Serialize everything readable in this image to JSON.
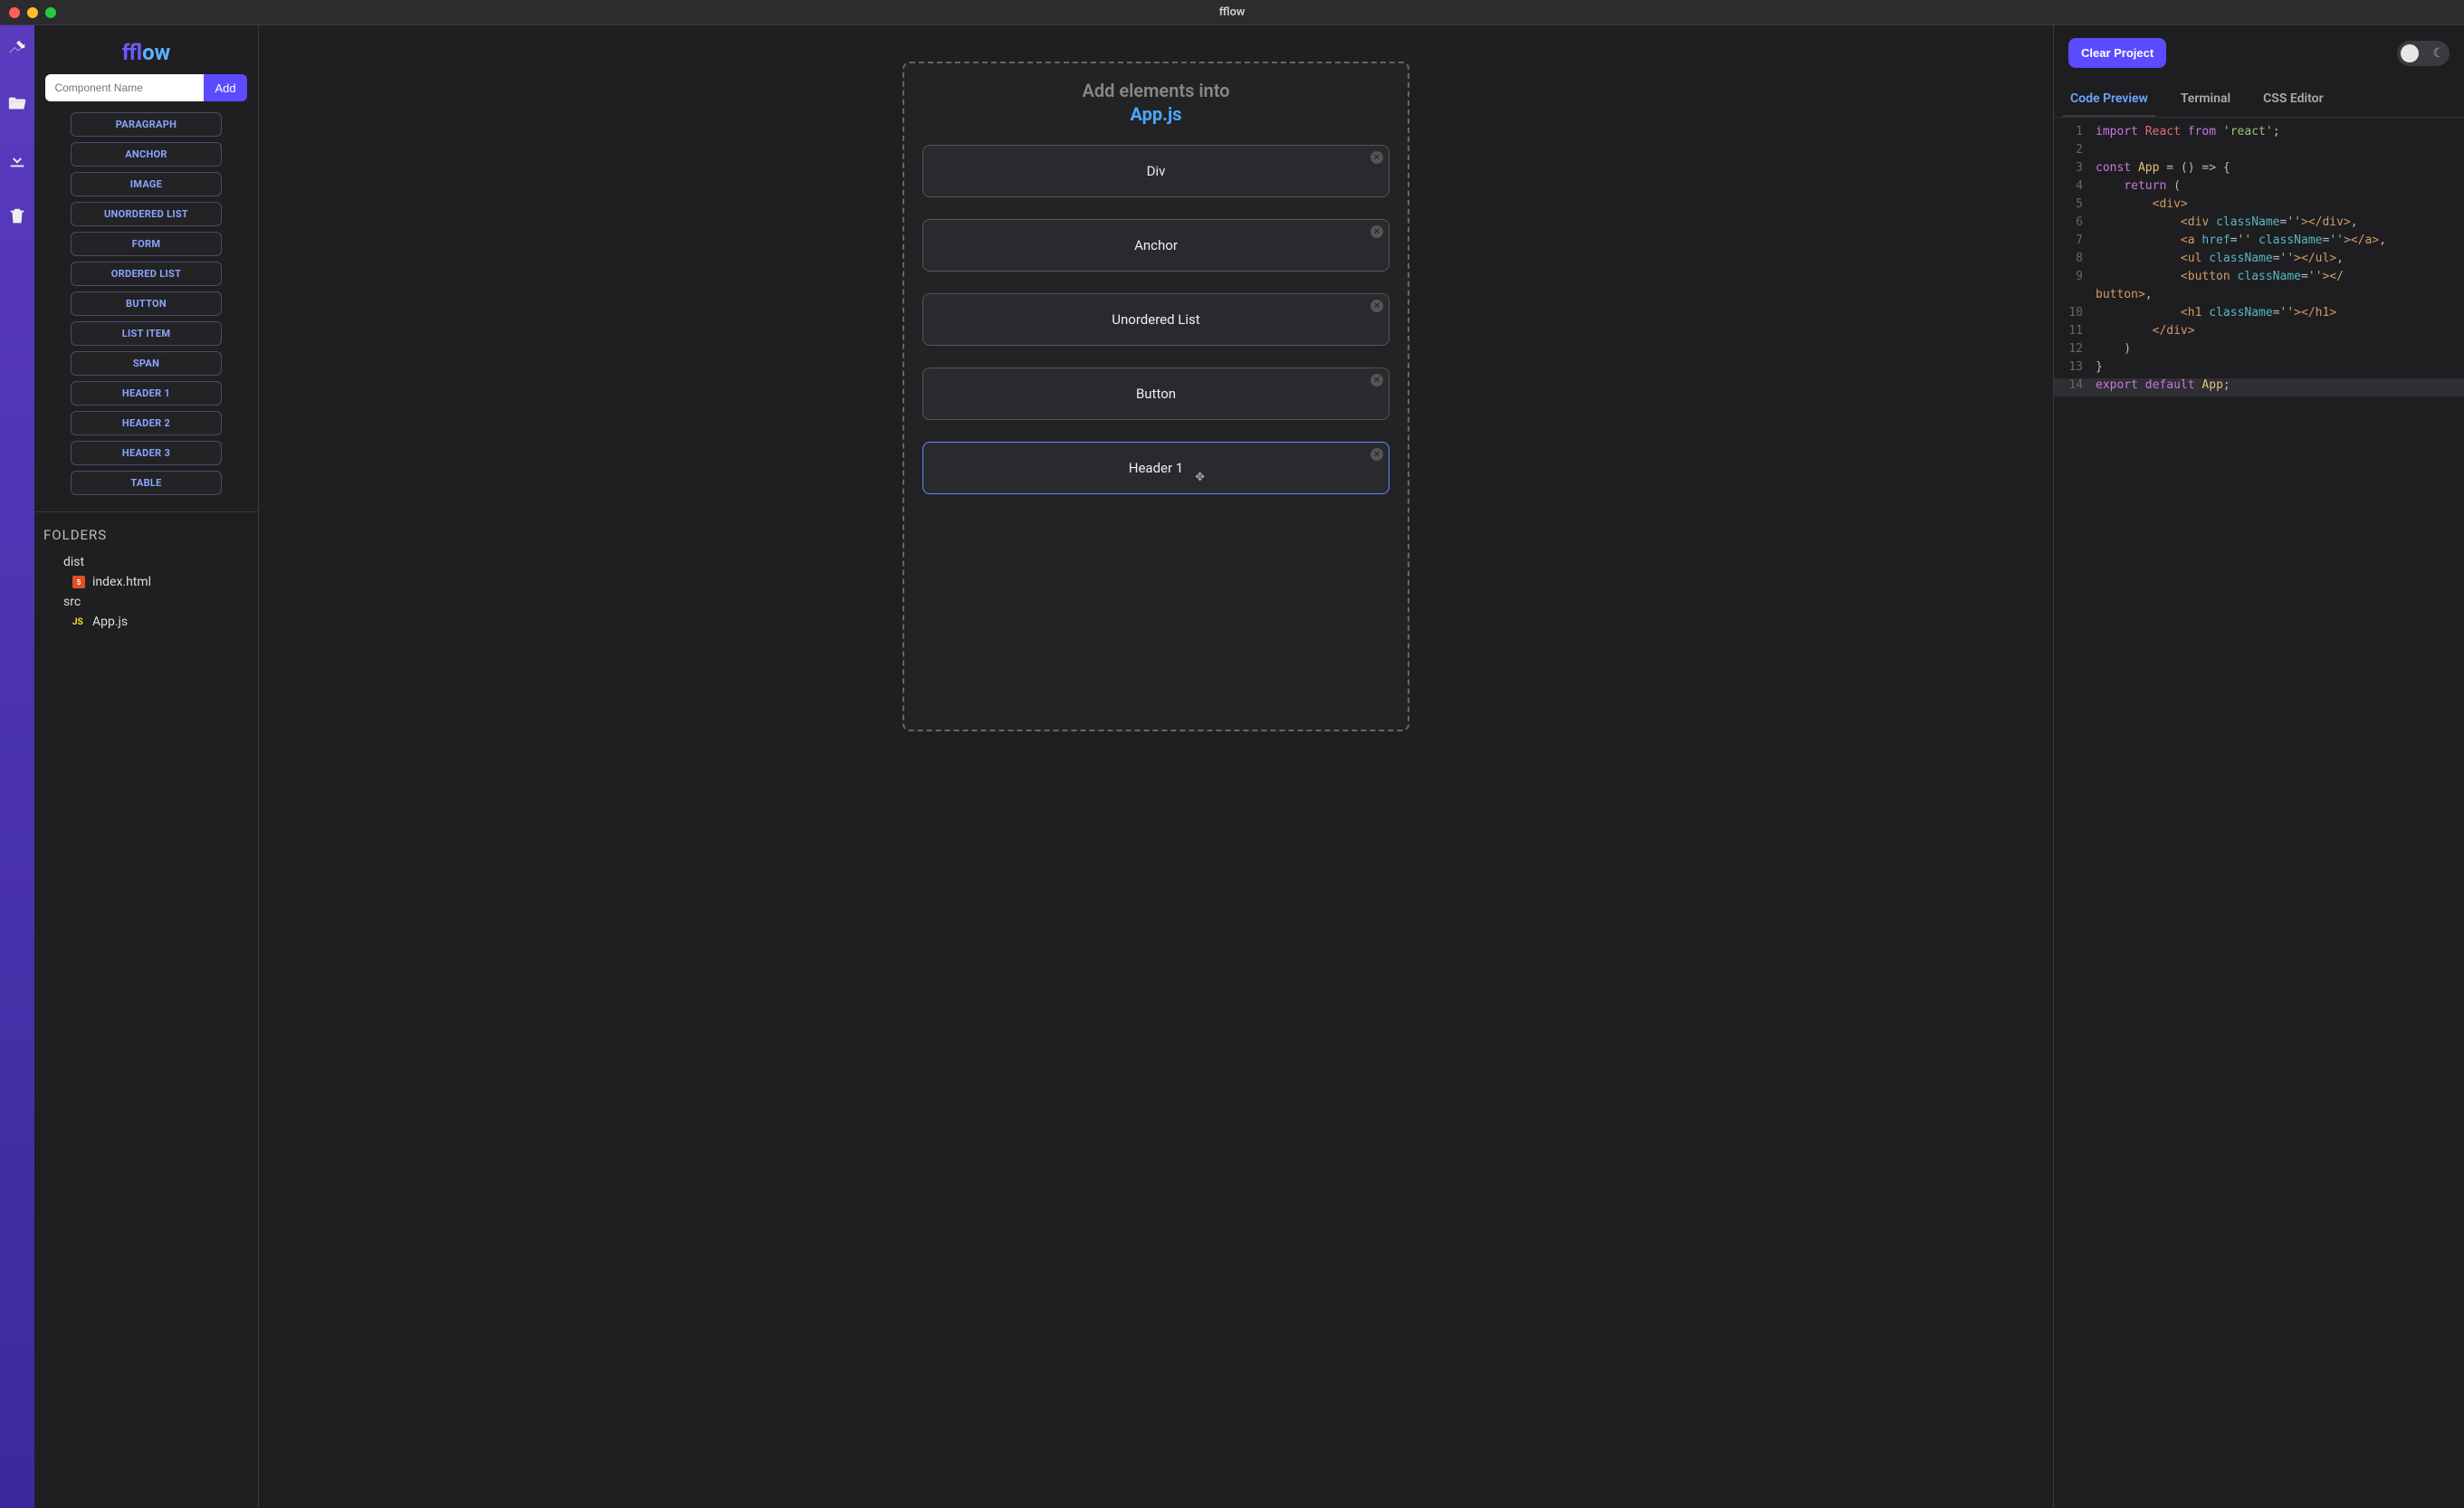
{
  "window": {
    "title": "fflow"
  },
  "rail": {
    "icons": [
      "design-icon",
      "folder-open-icon",
      "download-icon",
      "trash-icon"
    ]
  },
  "logo": {
    "part1": "ff",
    "part2": "low"
  },
  "component_input": {
    "placeholder": "Component Name",
    "value": ""
  },
  "add_button": {
    "label": "Add"
  },
  "tags": [
    "PARAGRAPH",
    "ANCHOR",
    "IMAGE",
    "UNORDERED LIST",
    "FORM",
    "ORDERED LIST",
    "BUTTON",
    "LIST ITEM",
    "SPAN",
    "HEADER 1",
    "HEADER 2",
    "HEADER 3",
    "TABLE"
  ],
  "folders": {
    "title": "FOLDERS",
    "tree": [
      {
        "type": "folder",
        "name": "dist",
        "depth": 1
      },
      {
        "type": "file",
        "name": "index.html",
        "kind": "html",
        "depth": 2
      },
      {
        "type": "folder",
        "name": "src",
        "depth": 1
      },
      {
        "type": "file",
        "name": "App.js",
        "kind": "js",
        "depth": 2
      }
    ]
  },
  "canvas": {
    "heading_line1": "Add elements into",
    "heading_line2": "App.js",
    "items": [
      {
        "label": "Div",
        "selected": false
      },
      {
        "label": "Anchor",
        "selected": false
      },
      {
        "label": "Unordered List",
        "selected": false
      },
      {
        "label": "Button",
        "selected": false
      },
      {
        "label": "Header 1",
        "selected": true
      }
    ]
  },
  "right": {
    "clear_label": "Clear Project",
    "dark_mode": true,
    "tabs": [
      {
        "label": "Code Preview",
        "active": true
      },
      {
        "label": "Terminal",
        "active": false
      },
      {
        "label": "CSS Editor",
        "active": false
      }
    ]
  },
  "code": {
    "lines": [
      {
        "n": 1,
        "tokens": [
          [
            "kw",
            "import"
          ],
          [
            "plain",
            " "
          ],
          [
            "react",
            "React"
          ],
          [
            "plain",
            " "
          ],
          [
            "kw",
            "from"
          ],
          [
            "plain",
            " "
          ],
          [
            "str",
            "'react'"
          ],
          [
            "plain",
            ";"
          ]
        ]
      },
      {
        "n": 2,
        "tokens": []
      },
      {
        "n": 3,
        "tokens": [
          [
            "kw",
            "const"
          ],
          [
            "plain",
            " "
          ],
          [
            "def",
            "App"
          ],
          [
            "plain",
            " = () => {"
          ]
        ]
      },
      {
        "n": 4,
        "tokens": [
          [
            "plain",
            "    "
          ],
          [
            "kw",
            "return"
          ],
          [
            "plain",
            " ("
          ]
        ]
      },
      {
        "n": 5,
        "tokens": [
          [
            "plain",
            "        "
          ],
          [
            "tag",
            "<div>"
          ]
        ]
      },
      {
        "n": 6,
        "tokens": [
          [
            "plain",
            "            "
          ],
          [
            "tag",
            "<div"
          ],
          [
            "plain",
            " "
          ],
          [
            "attr",
            "className"
          ],
          [
            "plain",
            "="
          ],
          [
            "str",
            "''"
          ],
          [
            "tag",
            "></div>"
          ],
          [
            "plain",
            ","
          ]
        ]
      },
      {
        "n": 7,
        "tokens": [
          [
            "plain",
            "            "
          ],
          [
            "tag",
            "<a"
          ],
          [
            "plain",
            " "
          ],
          [
            "attr",
            "href"
          ],
          [
            "plain",
            "="
          ],
          [
            "str",
            "''"
          ],
          [
            "plain",
            " "
          ],
          [
            "attr",
            "className"
          ],
          [
            "plain",
            "="
          ],
          [
            "str",
            "''"
          ],
          [
            "tag",
            "></a>"
          ],
          [
            "plain",
            ","
          ]
        ]
      },
      {
        "n": 8,
        "tokens": [
          [
            "plain",
            "            "
          ],
          [
            "tag",
            "<ul"
          ],
          [
            "plain",
            " "
          ],
          [
            "attr",
            "className"
          ],
          [
            "plain",
            "="
          ],
          [
            "str",
            "''"
          ],
          [
            "tag",
            "></ul>"
          ],
          [
            "plain",
            ","
          ]
        ]
      },
      {
        "n": 9,
        "tokens": [
          [
            "plain",
            "            "
          ],
          [
            "tag",
            "<button"
          ],
          [
            "plain",
            " "
          ],
          [
            "attr",
            "className"
          ],
          [
            "plain",
            "="
          ],
          [
            "str",
            "''"
          ],
          [
            "tag",
            "></"
          ]
        ],
        "continued": true
      },
      {
        "n": null,
        "tokens": [
          [
            "tag",
            "button>"
          ],
          [
            "plain",
            ","
          ]
        ]
      },
      {
        "n": 10,
        "tokens": [
          [
            "plain",
            "            "
          ],
          [
            "tag",
            "<h1"
          ],
          [
            "plain",
            " "
          ],
          [
            "attr",
            "className"
          ],
          [
            "plain",
            "="
          ],
          [
            "str",
            "''"
          ],
          [
            "tag",
            "></h1>"
          ]
        ]
      },
      {
        "n": 11,
        "tokens": [
          [
            "plain",
            "        "
          ],
          [
            "tag",
            "</div>"
          ]
        ]
      },
      {
        "n": 12,
        "tokens": [
          [
            "plain",
            "    )"
          ]
        ]
      },
      {
        "n": 13,
        "tokens": [
          [
            "plain",
            "}"
          ]
        ]
      },
      {
        "n": 14,
        "hl": true,
        "tokens": [
          [
            "kw",
            "export"
          ],
          [
            "plain",
            " "
          ],
          [
            "kw",
            "default"
          ],
          [
            "plain",
            " "
          ],
          [
            "def",
            "App"
          ],
          [
            "plain",
            ";"
          ]
        ]
      }
    ]
  }
}
